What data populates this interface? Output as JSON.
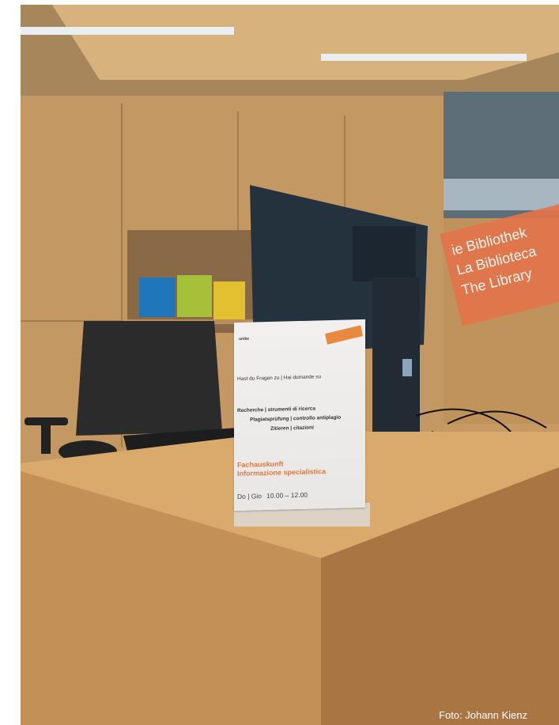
{
  "photo": {
    "description_alt": "Library help desk",
    "credit": "Foto: Johann Kienz"
  },
  "sign": {
    "logo": "unibz",
    "question": "Hast du Fragen zu | Hai domande su",
    "topics": [
      "Recherche | strumenti di ricerca",
      "Plagiatsprüfung | controllo antiplagio",
      "Zitieren | citazioni"
    ],
    "heading_de": "Fachauskunft",
    "heading_it": "Informazione specialistica",
    "days": "Do | Gio",
    "time": "10.00 – 12.00"
  },
  "window_banner": {
    "line1": "ie Bibliothek",
    "line2": "La Biblioteca",
    "line3": "The Library"
  },
  "colors": {
    "wood": "#c79a64",
    "accent_orange": "#e3744a",
    "monitor": "#2a3a48"
  }
}
